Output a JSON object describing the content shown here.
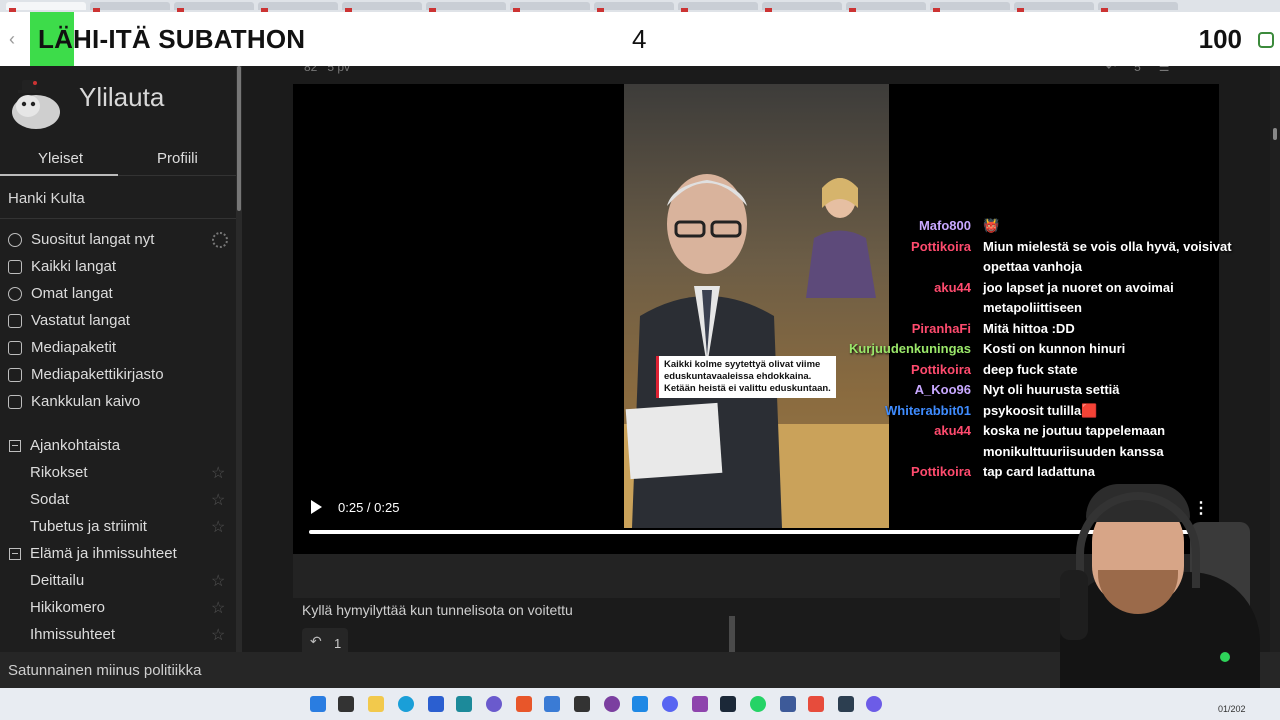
{
  "banner": {
    "title": "LÄHI-ITÄ SUBATHON",
    "count": "4",
    "goal": "100"
  },
  "sidebar": {
    "logo_text": "Ylilauta",
    "tabs": [
      "Yleiset",
      "Profiili"
    ],
    "gold": "Hanki Kulta",
    "menu": [
      {
        "label": "Suositut langat nyt",
        "icon": "flame-icon"
      },
      {
        "label": "Kaikki langat",
        "icon": "list-icon"
      },
      {
        "label": "Omat langat",
        "icon": "chat-icon"
      },
      {
        "label": "Vastatut langat",
        "icon": "reply-icon"
      },
      {
        "label": "Mediapaketit",
        "icon": "media-icon"
      },
      {
        "label": "Mediapakettikirjasto",
        "icon": "library-icon"
      },
      {
        "label": "Kankkulan kaivo",
        "icon": "well-icon"
      }
    ],
    "categories": [
      {
        "label": "Ajankohtaista",
        "items": [
          "Rikokset",
          "Sodat",
          "Tubetus ja striimit"
        ]
      },
      {
        "label": "Elämä ja ihmissuhteet",
        "items": [
          "Deittailu",
          "Hikikomero",
          "Ihmissuhteet"
        ]
      }
    ]
  },
  "post": {
    "meta_ago": "5 pv",
    "meta_id": "82",
    "reply_count": "5",
    "video_time": "0:25 / 0:25",
    "progress": 1.0,
    "caption": "Kaikki kolme syytettyä olivat viime eduskuntavaaleissa ehdokkaina. Ketään heistä ei valittu eduskuntaan.",
    "media_label": "dia",
    "comment": "Kyllä hymyilyttää kun tunnelisota on voitettu",
    "replies": "1"
  },
  "chat": [
    {
      "name": "Mafo800",
      "color": "#c8a8ff",
      "text": "👹"
    },
    {
      "name": "Pottikoira",
      "color": "#ff4b6e",
      "text": "Miun mielestä se vois olla hyvä, voisivat opettaa vanhoja"
    },
    {
      "name": "aku44",
      "color": "#ff4b6e",
      "text": "joo lapset ja nuoret on avoimai metapoliittiseen"
    },
    {
      "name": "PiranhaFi",
      "color": "#ff4b6e",
      "text": "Mitä hittoa :DD"
    },
    {
      "name": "Kurjuudenkuningas",
      "color": "#9be86a",
      "text": "Kosti on kunnon hinuri"
    },
    {
      "name": "Pottikoira",
      "color": "#ff4b6e",
      "text": "deep fuck state"
    },
    {
      "name": "A_Koo96",
      "color": "#c8a8ff",
      "text": "Nyt oli huurusta settiä"
    },
    {
      "name": "Whiterabbit01",
      "color": "#3f8cff",
      "text": "psykoosit tulilla🟥"
    },
    {
      "name": "aku44",
      "color": "#ff4b6e",
      "text": "koska ne joutuu tappelemaan monikulttuuriisuuden kanssa"
    },
    {
      "name": "Pottikoira",
      "color": "#ff4b6e",
      "text": "tap card ladattuna"
    }
  ],
  "bottombar": {
    "text": "Satunnainen miinus politiikka"
  },
  "taskbar": {
    "clock": "01/202"
  }
}
